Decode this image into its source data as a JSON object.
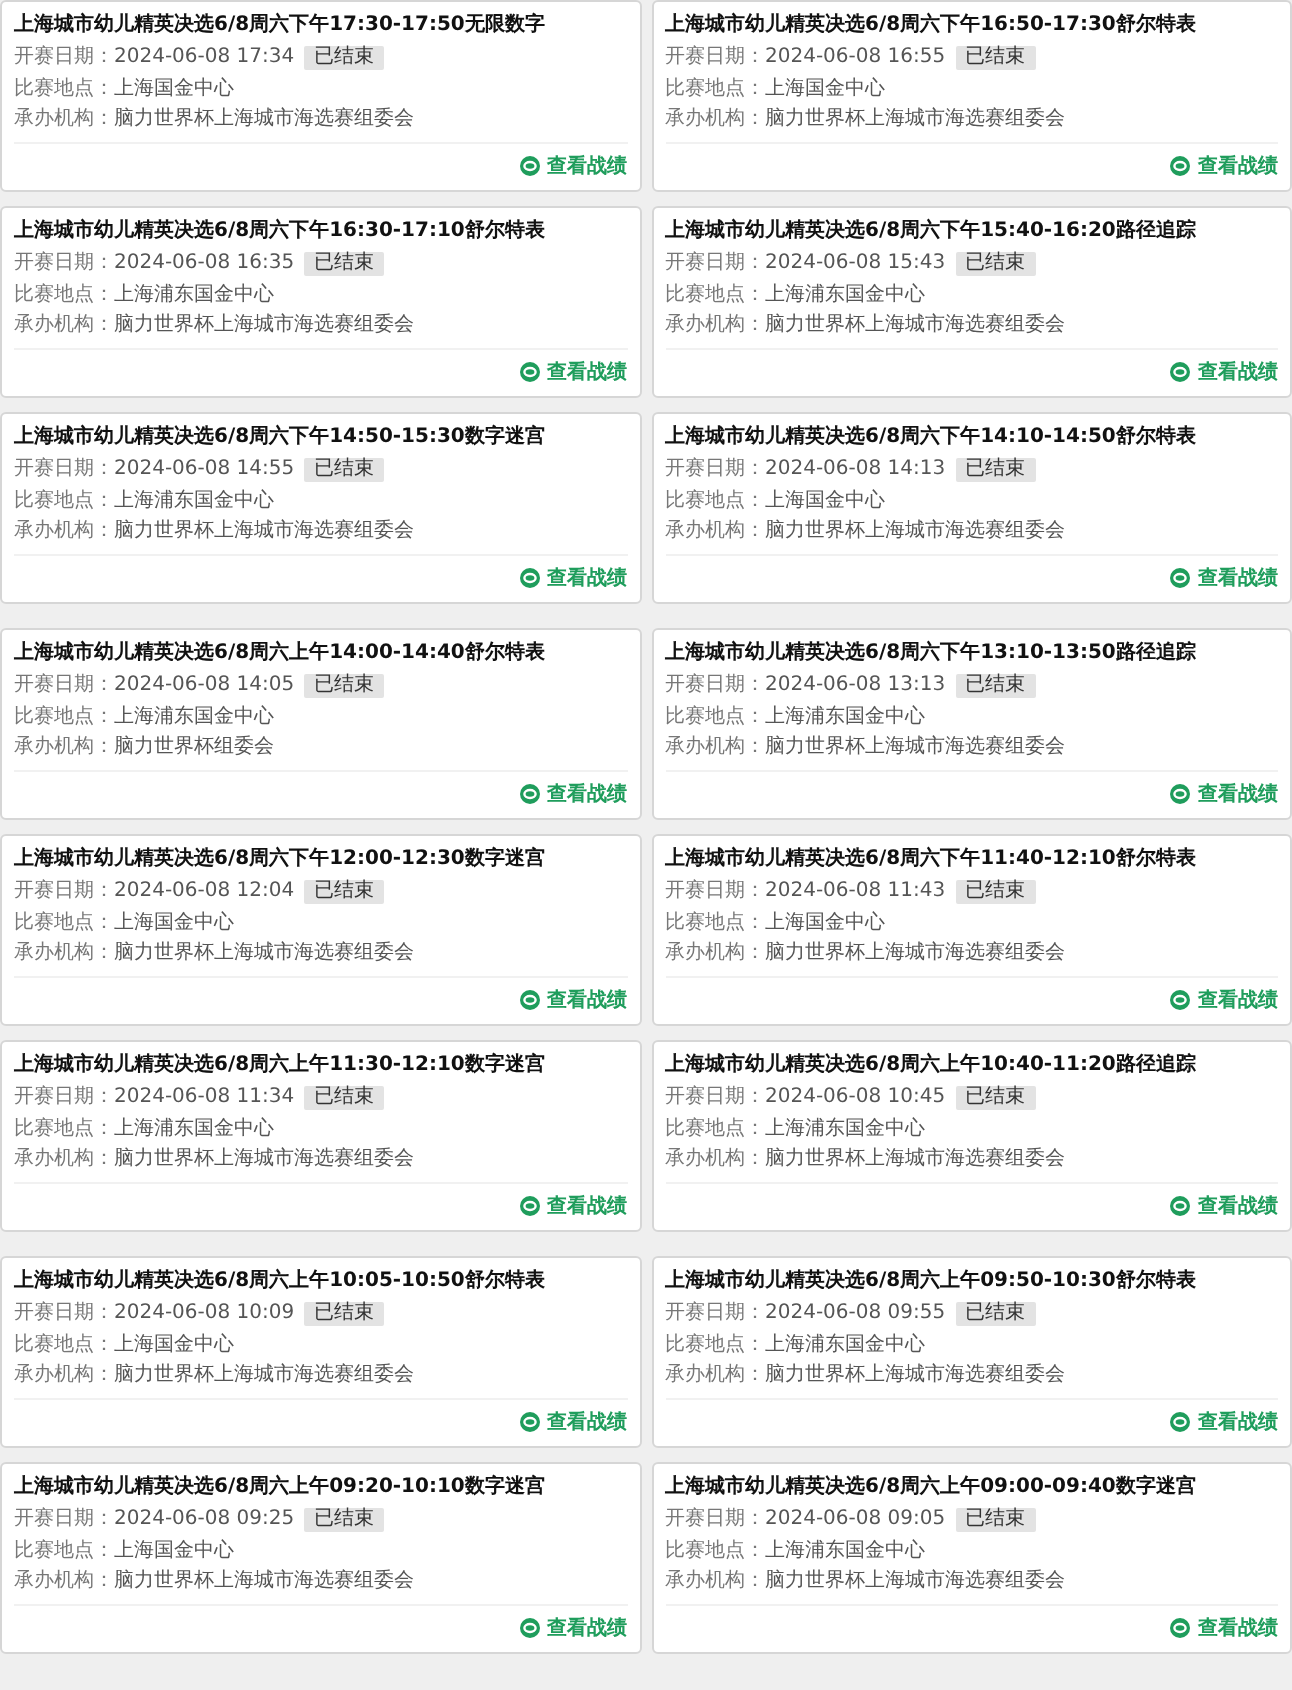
{
  "sections": [
    {
      "cards": [
        {
          "title": "上海城市幼儿精英决选6/8周六下午17:30-17:50无限数字",
          "date_label": "开赛日期：",
          "date": "2024-06-08 17:34",
          "status": "已结束",
          "venue_label": "比赛地点：",
          "venue": "上海国金中心",
          "organizer_label": "承办机构：",
          "organizer": "脑力世界杯上海城市海选赛组委会",
          "action": "查看战绩"
        },
        {
          "title": "上海城市幼儿精英决选6/8周六下午16:50-17:30舒尔特表",
          "date_label": "开赛日期：",
          "date": "2024-06-08 16:55",
          "status": "已结束",
          "venue_label": "比赛地点：",
          "venue": "上海国金中心",
          "organizer_label": "承办机构：",
          "organizer": "脑力世界杯上海城市海选赛组委会",
          "action": "查看战绩"
        },
        {
          "title": "上海城市幼儿精英决选6/8周六下午16:30-17:10舒尔特表",
          "date_label": "开赛日期：",
          "date": "2024-06-08 16:35",
          "status": "已结束",
          "venue_label": "比赛地点：",
          "venue": "上海浦东国金中心",
          "organizer_label": "承办机构：",
          "organizer": "脑力世界杯上海城市海选赛组委会",
          "action": "查看战绩"
        },
        {
          "title": "上海城市幼儿精英决选6/8周六下午15:40-16:20路径追踪",
          "date_label": "开赛日期：",
          "date": "2024-06-08 15:43",
          "status": "已结束",
          "venue_label": "比赛地点：",
          "venue": "上海浦东国金中心",
          "organizer_label": "承办机构：",
          "organizer": "脑力世界杯上海城市海选赛组委会",
          "action": "查看战绩"
        },
        {
          "title": "上海城市幼儿精英决选6/8周六下午14:50-15:30数字迷宫",
          "date_label": "开赛日期：",
          "date": "2024-06-08 14:55",
          "status": "已结束",
          "venue_label": "比赛地点：",
          "venue": "上海浦东国金中心",
          "organizer_label": "承办机构：",
          "organizer": "脑力世界杯上海城市海选赛组委会",
          "action": "查看战绩"
        },
        {
          "title": "上海城市幼儿精英决选6/8周六下午14:10-14:50舒尔特表",
          "date_label": "开赛日期：",
          "date": "2024-06-08 14:13",
          "status": "已结束",
          "venue_label": "比赛地点：",
          "venue": "上海国金中心",
          "organizer_label": "承办机构：",
          "organizer": "脑力世界杯上海城市海选赛组委会",
          "action": "查看战绩"
        }
      ]
    },
    {
      "cards": [
        {
          "title": "上海城市幼儿精英决选6/8周六上午14:00-14:40舒尔特表",
          "date_label": "开赛日期：",
          "date": "2024-06-08 14:05",
          "status": "已结束",
          "venue_label": "比赛地点：",
          "venue": "上海浦东国金中心",
          "organizer_label": "承办机构：",
          "organizer": "脑力世界杯组委会",
          "action": "查看战绩"
        },
        {
          "title": "上海城市幼儿精英决选6/8周六下午13:10-13:50路径追踪",
          "date_label": "开赛日期：",
          "date": "2024-06-08 13:13",
          "status": "已结束",
          "venue_label": "比赛地点：",
          "venue": "上海浦东国金中心",
          "organizer_label": "承办机构：",
          "organizer": "脑力世界杯上海城市海选赛组委会",
          "action": "查看战绩"
        },
        {
          "title": "上海城市幼儿精英决选6/8周六下午12:00-12:30数字迷宫",
          "date_label": "开赛日期：",
          "date": "2024-06-08 12:04",
          "status": "已结束",
          "venue_label": "比赛地点：",
          "venue": "上海国金中心",
          "organizer_label": "承办机构：",
          "organizer": "脑力世界杯上海城市海选赛组委会",
          "action": "查看战绩"
        },
        {
          "title": "上海城市幼儿精英决选6/8周六下午11:40-12:10舒尔特表",
          "date_label": "开赛日期：",
          "date": "2024-06-08 11:43",
          "status": "已结束",
          "venue_label": "比赛地点：",
          "venue": "上海国金中心",
          "organizer_label": "承办机构：",
          "organizer": "脑力世界杯上海城市海选赛组委会",
          "action": "查看战绩"
        },
        {
          "title": "上海城市幼儿精英决选6/8周六上午11:30-12:10数字迷宫",
          "date_label": "开赛日期：",
          "date": "2024-06-08 11:34",
          "status": "已结束",
          "venue_label": "比赛地点：",
          "venue": "上海浦东国金中心",
          "organizer_label": "承办机构：",
          "organizer": "脑力世界杯上海城市海选赛组委会",
          "action": "查看战绩"
        },
        {
          "title": "上海城市幼儿精英决选6/8周六上午10:40-11:20路径追踪",
          "date_label": "开赛日期：",
          "date": "2024-06-08 10:45",
          "status": "已结束",
          "venue_label": "比赛地点：",
          "venue": "上海浦东国金中心",
          "organizer_label": "承办机构：",
          "organizer": "脑力世界杯上海城市海选赛组委会",
          "action": "查看战绩"
        }
      ]
    },
    {
      "cards": [
        {
          "title": "上海城市幼儿精英决选6/8周六上午10:05-10:50舒尔特表",
          "date_label": "开赛日期：",
          "date": "2024-06-08 10:09",
          "status": "已结束",
          "venue_label": "比赛地点：",
          "venue": "上海国金中心",
          "organizer_label": "承办机构：",
          "organizer": "脑力世界杯上海城市海选赛组委会",
          "action": "查看战绩"
        },
        {
          "title": "上海城市幼儿精英决选6/8周六上午09:50-10:30舒尔特表",
          "date_label": "开赛日期：",
          "date": "2024-06-08 09:55",
          "status": "已结束",
          "venue_label": "比赛地点：",
          "venue": "上海浦东国金中心",
          "organizer_label": "承办机构：",
          "organizer": "脑力世界杯上海城市海选赛组委会",
          "action": "查看战绩"
        },
        {
          "title": "上海城市幼儿精英决选6/8周六上午09:20-10:10数字迷宫",
          "date_label": "开赛日期：",
          "date": "2024-06-08 09:25",
          "status": "已结束",
          "venue_label": "比赛地点：",
          "venue": "上海国金中心",
          "organizer_label": "承办机构：",
          "organizer": "脑力世界杯上海城市海选赛组委会",
          "action": "查看战绩"
        },
        {
          "title": "上海城市幼儿精英决选6/8周六上午09:00-09:40数字迷宫",
          "date_label": "开赛日期：",
          "date": "2024-06-08 09:05",
          "status": "已结束",
          "venue_label": "比赛地点：",
          "venue": "上海浦东国金中心",
          "organizer_label": "承办机构：",
          "organizer": "脑力世界杯上海城市海选赛组委会",
          "action": "查看战绩"
        }
      ]
    }
  ]
}
